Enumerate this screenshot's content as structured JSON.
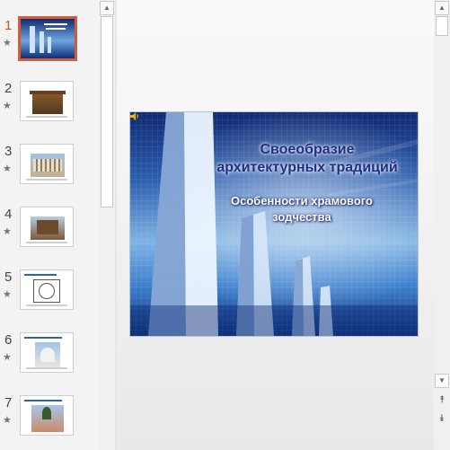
{
  "thumbnails": [
    {
      "number": "1",
      "caption": "",
      "selected": true
    },
    {
      "number": "2",
      "caption": "",
      "selected": false
    },
    {
      "number": "3",
      "caption": "",
      "selected": false
    },
    {
      "number": "4",
      "caption": "",
      "selected": false
    },
    {
      "number": "5",
      "caption": "",
      "selected": false
    },
    {
      "number": "6",
      "caption": "",
      "selected": false
    },
    {
      "number": "7",
      "caption": "",
      "selected": false
    }
  ],
  "thumb_star_glyph": "★",
  "scroll": {
    "up_glyph": "▲",
    "down_glyph": "▼",
    "prev_slide_glyph": "⯭",
    "next_slide_glyph": "⯯"
  },
  "slide": {
    "title": "Своеобразие архитектурных традиций",
    "subtitle": "Особенности храмового зодчества"
  },
  "colors": {
    "selected_accent": "#d35b3a",
    "title_color": "#1e2f86"
  }
}
